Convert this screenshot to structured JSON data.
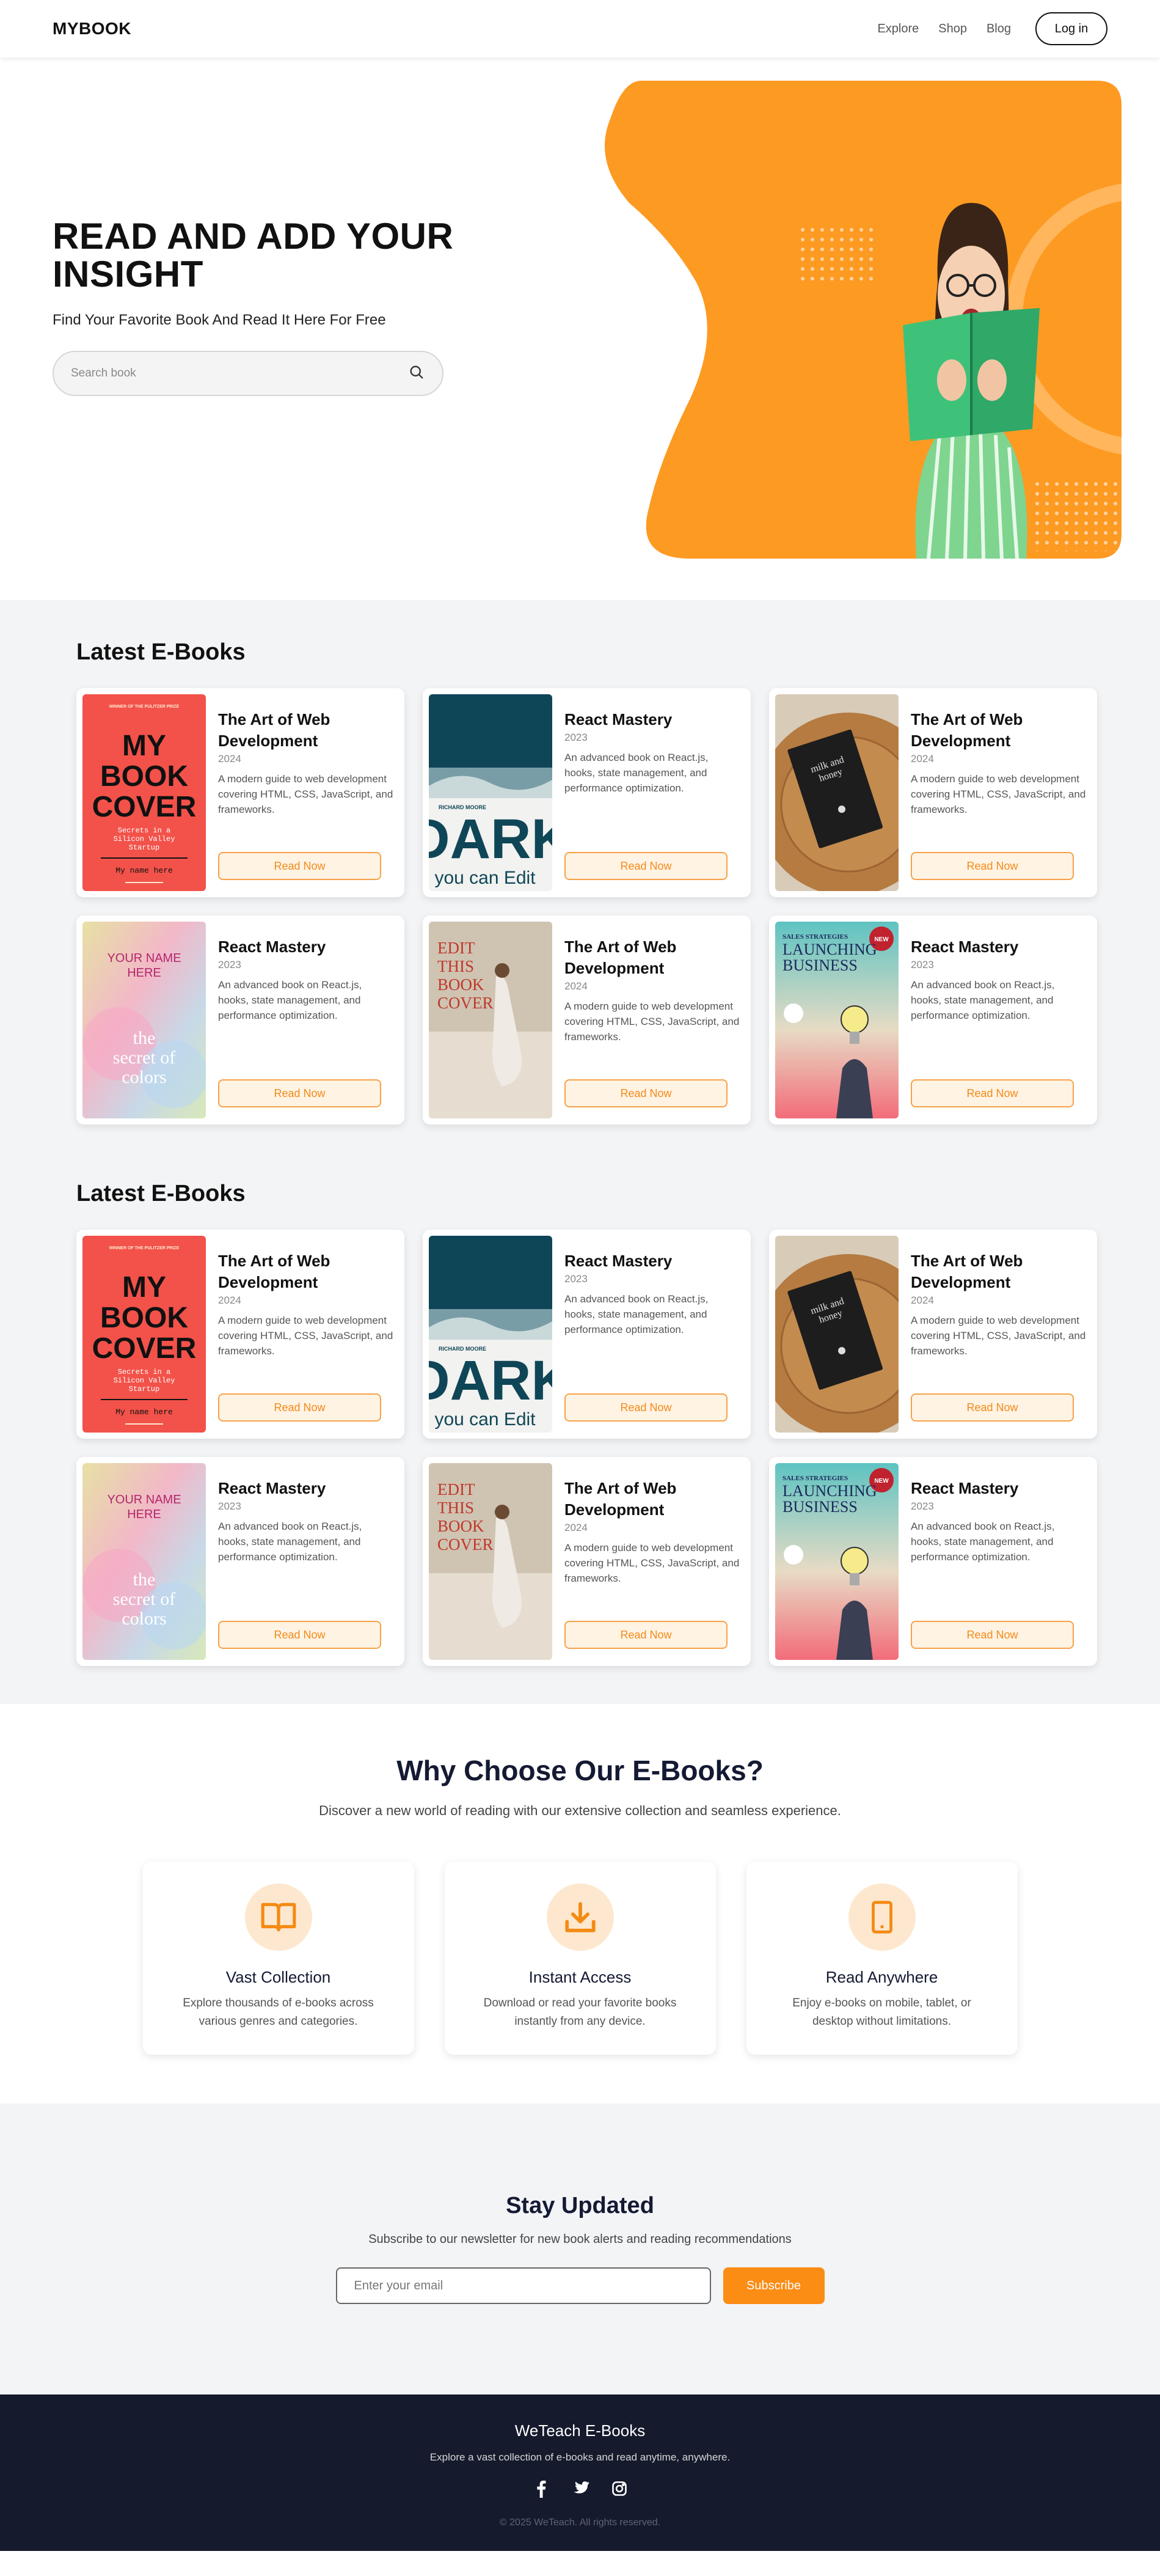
{
  "nav": {
    "logo": "MYBOOK",
    "links": [
      "Explore",
      "Shop",
      "Blog"
    ],
    "login": "Log in"
  },
  "hero": {
    "title": "READ AND ADD YOUR INSIGHT",
    "subtitle": "Find Your Favorite Book And Read It Here For Free",
    "search_placeholder": "Search book",
    "accent": "#fd9a22"
  },
  "sections": [
    {
      "title": "Latest E-Books",
      "books": [
        {
          "title": "The Art of Web Development",
          "year": "2024",
          "desc": "A modern guide to web development covering HTML, CSS, JavaScript, and frameworks.",
          "cta": "Read Now",
          "cover": "red"
        },
        {
          "title": "React Mastery",
          "year": "2023",
          "desc": "An advanced book on React.js, hooks, state management, and performance optimization.",
          "cta": "Read Now",
          "cover": "dark"
        },
        {
          "title": "The Art of Web Development",
          "year": "2024",
          "desc": "A modern guide to web development covering HTML, CSS, JavaScript, and frameworks.",
          "cta": "Read Now",
          "cover": "wood"
        },
        {
          "title": "React Mastery",
          "year": "2023",
          "desc": "An advanced book on React.js, hooks, state management, and performance optimization.",
          "cta": "Read Now",
          "cover": "pastel"
        },
        {
          "title": "The Art of Web Development",
          "year": "2024",
          "desc": "A modern guide to web development covering HTML, CSS, JavaScript, and frameworks.",
          "cta": "Read Now",
          "cover": "edit"
        },
        {
          "title": "React Mastery",
          "year": "2023",
          "desc": "An advanced book on React.js, hooks, state management, and performance optimization.",
          "cta": "Read Now",
          "cover": "launch"
        }
      ]
    },
    {
      "title": "Latest E-Books",
      "books": [
        {
          "title": "The Art of Web Development",
          "year": "2024",
          "desc": "A modern guide to web development covering HTML, CSS, JavaScript, and frameworks.",
          "cta": "Read Now",
          "cover": "red"
        },
        {
          "title": "React Mastery",
          "year": "2023",
          "desc": "An advanced book on React.js, hooks, state management, and performance optimization.",
          "cta": "Read Now",
          "cover": "dark"
        },
        {
          "title": "The Art of Web Development",
          "year": "2024",
          "desc": "A modern guide to web development covering HTML, CSS, JavaScript, and frameworks.",
          "cta": "Read Now",
          "cover": "wood"
        },
        {
          "title": "React Mastery",
          "year": "2023",
          "desc": "An advanced book on React.js, hooks, state management, and performance optimization.",
          "cta": "Read Now",
          "cover": "pastel"
        },
        {
          "title": "The Art of Web Development",
          "year": "2024",
          "desc": "A modern guide to web development covering HTML, CSS, JavaScript, and frameworks.",
          "cta": "Read Now",
          "cover": "edit"
        },
        {
          "title": "React Mastery",
          "year": "2023",
          "desc": "An advanced book on React.js, hooks, state management, and performance optimization.",
          "cta": "Read Now",
          "cover": "launch"
        }
      ]
    }
  ],
  "cover_text": {
    "red": {
      "top": "WINNER OF THE PULITZER PRIZE",
      "title": "MY BOOK COVER",
      "tagline": "Secrets in a Silicon Valley Startup",
      "author": "My name here"
    },
    "dark": {
      "author": "RICHARD MOORE",
      "title": "DARK",
      "tagline": "you can Edit"
    },
    "wood": {
      "title": "milk and honey"
    },
    "pastel": {
      "name": "YOUR NAME HERE",
      "title": "the secret of colors"
    },
    "edit": {
      "title": "EDIT THIS BOOK COVER"
    },
    "launch": {
      "kicker": "SALES STRATEGIES",
      "title": "LAUNCHING BUSINESS",
      "badge": "NEW"
    }
  },
  "why": {
    "title": "Why Choose Our E-Books?",
    "subtitle": "Discover a new world of reading with our extensive collection and seamless experience.",
    "features": [
      {
        "icon": "book-open-icon",
        "title": "Vast Collection",
        "desc": "Explore thousands of e-books across various genres and categories."
      },
      {
        "icon": "download-icon",
        "title": "Instant Access",
        "desc": "Download or read your favorite books instantly from any device."
      },
      {
        "icon": "tablet-icon",
        "title": "Read Anywhere",
        "desc": "Enjoy e-books on mobile, tablet, or desktop without limitations."
      }
    ]
  },
  "newsletter": {
    "title": "Stay Updated",
    "subtitle": "Subscribe to our newsletter for new book alerts and reading recommendations",
    "placeholder": "Enter your email",
    "button": "Subscribe"
  },
  "footer": {
    "title": "WeTeach E-Books",
    "subtitle": "Explore a vast collection of e-books and read anytime, anywhere.",
    "socials": [
      "facebook-icon",
      "twitter-icon",
      "instagram-icon"
    ],
    "copyright": "© 2025 WeTeach. All rights reserved."
  }
}
